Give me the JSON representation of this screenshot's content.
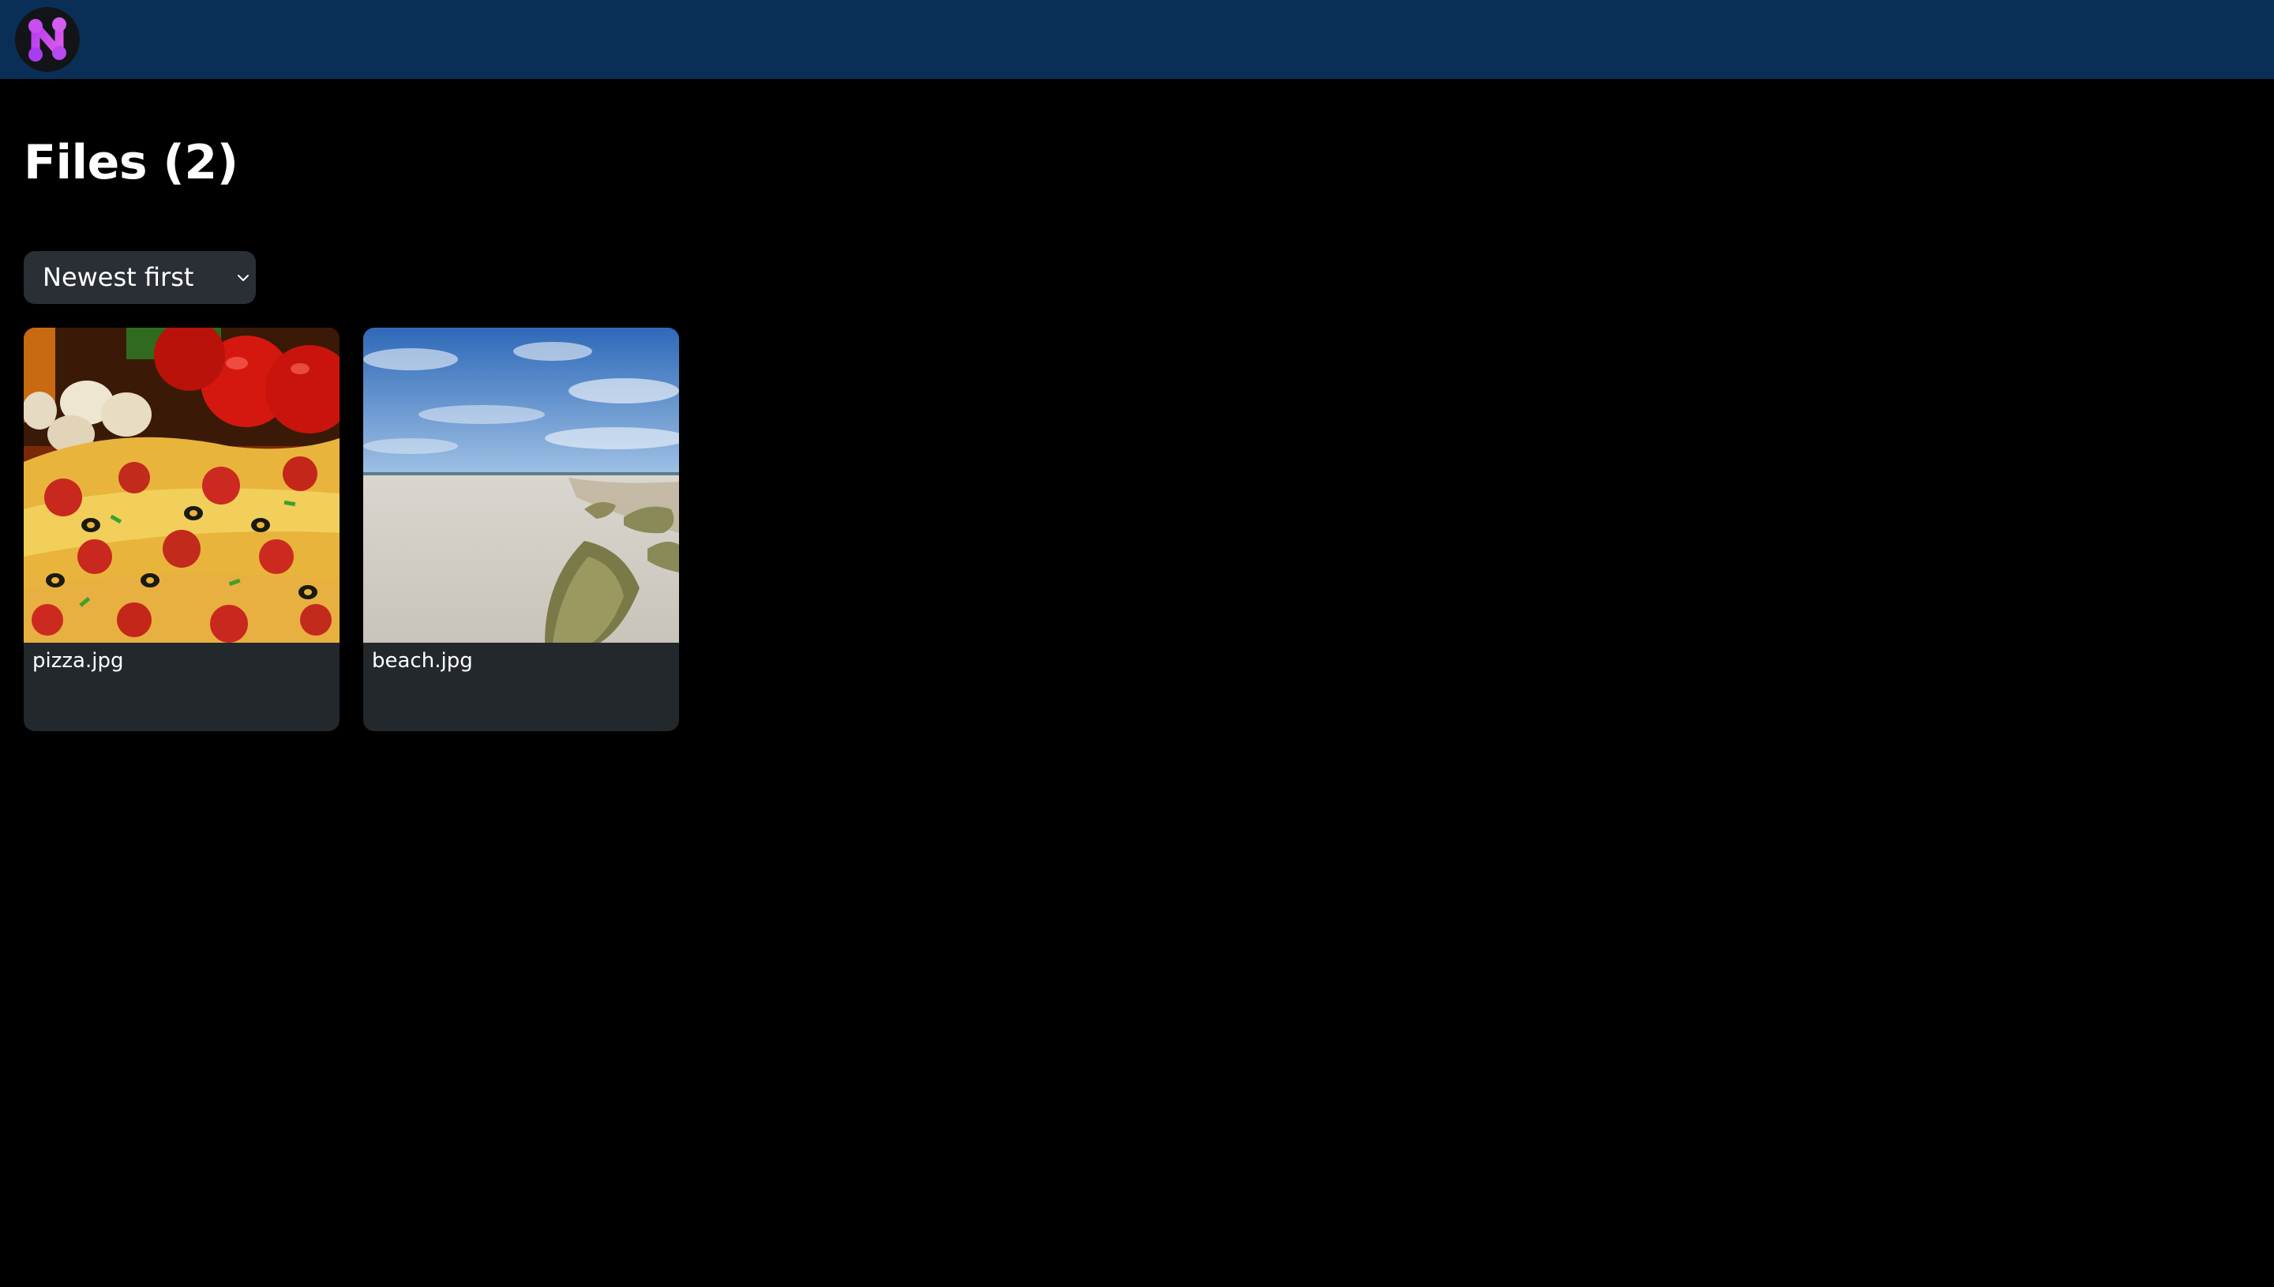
{
  "app": {
    "logo_icon": "app-logo-icon",
    "accent_color": "#0a2f57"
  },
  "page": {
    "title": "Files (2)"
  },
  "sort": {
    "selected": "Newest first",
    "icon": "chevron-down-icon"
  },
  "files": [
    {
      "name": "pizza.jpg",
      "thumbnail": "pizza-image"
    },
    {
      "name": "beach.jpg",
      "thumbnail": "beach-image"
    }
  ]
}
